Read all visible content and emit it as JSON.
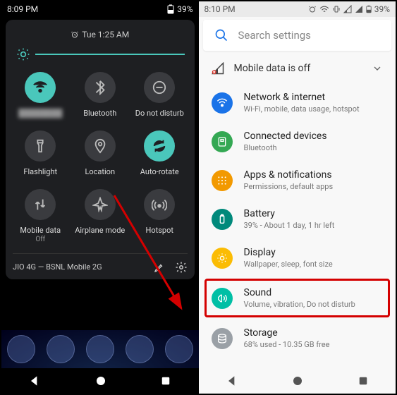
{
  "left": {
    "status_time": "8:09 PM",
    "battery_pct": "39%",
    "alarm_text": "Tue 1:25 AM",
    "tiles": [
      {
        "name": "wifi",
        "label": "",
        "sub": "",
        "on": true
      },
      {
        "name": "bluetooth",
        "label": "Bluetooth",
        "sub": "",
        "on": false
      },
      {
        "name": "dnd",
        "label": "Do not disturb",
        "sub": "",
        "on": false
      },
      {
        "name": "flashlight",
        "label": "Flashlight",
        "sub": "",
        "on": false
      },
      {
        "name": "location",
        "label": "Location",
        "sub": "",
        "on": false
      },
      {
        "name": "autorotate",
        "label": "Auto-rotate",
        "sub": "",
        "on": true
      },
      {
        "name": "mobiledata",
        "label": "Mobile data",
        "sub": "Off",
        "on": false
      },
      {
        "name": "airplane",
        "label": "Airplane mode",
        "sub": "",
        "on": false
      },
      {
        "name": "hotspot",
        "label": "Hotspot",
        "sub": "",
        "on": false
      }
    ],
    "footer_text": "JIO 4G — BSNL Mobile 2G"
  },
  "right": {
    "status_time": "8:10 PM",
    "battery_pct": "39%",
    "search_placeholder": "Search settings",
    "banner_text": "Mobile data is off",
    "items": [
      {
        "icon_color": "#1a73e8",
        "title": "Network & internet",
        "sub": "Wi-Fi, mobile, data usage, hotspot"
      },
      {
        "icon_color": "#34a853",
        "title": "Connected devices",
        "sub": "Bluetooth"
      },
      {
        "icon_color": "#f29900",
        "title": "Apps & notifications",
        "sub": "Permissions, default apps"
      },
      {
        "icon_color": "#00897b",
        "title": "Battery",
        "sub": "39% - About 1 day, 1 hr left"
      },
      {
        "icon_color": "#fbbc04",
        "title": "Display",
        "sub": "Wallpaper, sleep, font size"
      },
      {
        "icon_color": "#00bfa5",
        "title": "Sound",
        "sub": "Volume, vibration, Do not disturb",
        "highlight": true
      },
      {
        "icon_color": "#9aa0a6",
        "title": "Storage",
        "sub": "68% used - 10.35 GB free"
      }
    ]
  }
}
